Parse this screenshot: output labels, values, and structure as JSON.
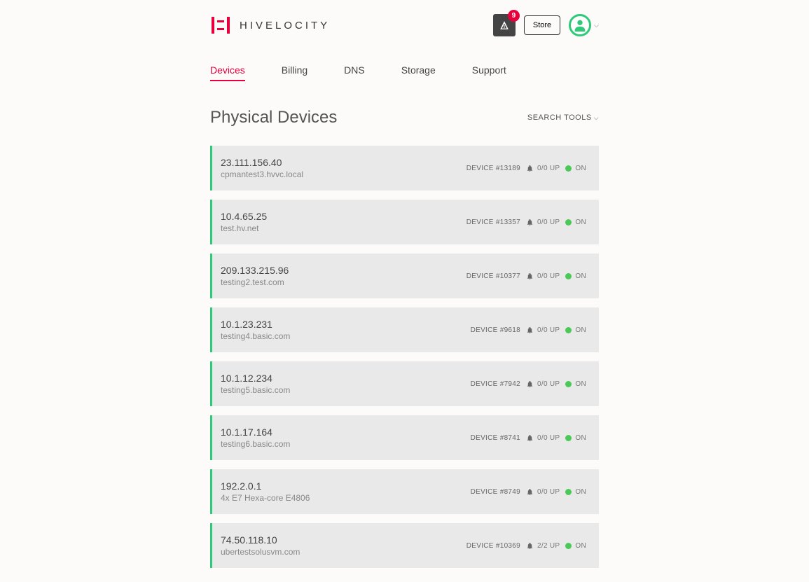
{
  "header": {
    "logo_text": "HIVELOCITY",
    "notification_count": "9",
    "store_label": "Store"
  },
  "nav": {
    "tabs": [
      {
        "label": "Devices",
        "active": true
      },
      {
        "label": "Billing",
        "active": false
      },
      {
        "label": "DNS",
        "active": false
      },
      {
        "label": "Storage",
        "active": false
      },
      {
        "label": "Support",
        "active": false
      }
    ]
  },
  "page": {
    "title": "Physical Devices",
    "search_tools_label": "SEARCH TOOLS"
  },
  "devices": [
    {
      "ip": "23.111.156.40",
      "host": "cpmantest3.hvvc.local",
      "id_label": "DEVICE #13189",
      "up_label": "0/0 UP",
      "status_label": "ON"
    },
    {
      "ip": "10.4.65.25",
      "host": "test.hv.net",
      "id_label": "DEVICE #13357",
      "up_label": "0/0 UP",
      "status_label": "ON"
    },
    {
      "ip": "209.133.215.96",
      "host": "testing2.test.com",
      "id_label": "DEVICE #10377",
      "up_label": "0/0 UP",
      "status_label": "ON"
    },
    {
      "ip": "10.1.23.231",
      "host": "testing4.basic.com",
      "id_label": "DEVICE #9618",
      "up_label": "0/0 UP",
      "status_label": "ON"
    },
    {
      "ip": "10.1.12.234",
      "host": "testing5.basic.com",
      "id_label": "DEVICE #7942",
      "up_label": "0/0 UP",
      "status_label": "ON"
    },
    {
      "ip": "10.1.17.164",
      "host": "testing6.basic.com",
      "id_label": "DEVICE #8741",
      "up_label": "0/0 UP",
      "status_label": "ON"
    },
    {
      "ip": "192.2.0.1",
      "host": "4x E7 Hexa-core E4806",
      "id_label": "DEVICE #8749",
      "up_label": "0/0 UP",
      "status_label": "ON"
    },
    {
      "ip": "74.50.118.10",
      "host": "ubertestsolusvm.com",
      "id_label": "DEVICE #10369",
      "up_label": "2/2 UP",
      "status_label": "ON"
    }
  ]
}
